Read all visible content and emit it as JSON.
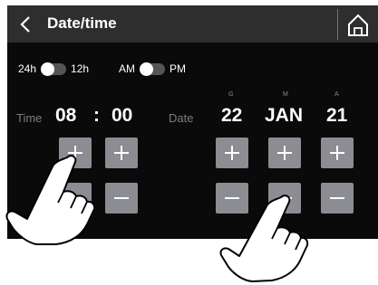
{
  "header": {
    "title": "Date/time",
    "back_icon": "chevron-left-icon",
    "home_icon": "home-icon"
  },
  "format_toggle": {
    "left_label": "24h",
    "right_label": "12h",
    "selected": "24h"
  },
  "meridiem_toggle": {
    "left_label": "AM",
    "right_label": "PM",
    "selected": "AM"
  },
  "time": {
    "label": "Time",
    "hours": "08",
    "separator": ":",
    "minutes": "00"
  },
  "date": {
    "label": "Date",
    "day_caption": "G",
    "day": "22",
    "month_caption": "M",
    "month": "JAN",
    "year_caption": "A",
    "year": "21"
  },
  "colors": {
    "screen_bg": "#0a0a0a",
    "header_bg": "#2e2e2e",
    "button": "#8c8c93",
    "text": "#ffffff",
    "dim_text": "#7d7d7d"
  }
}
